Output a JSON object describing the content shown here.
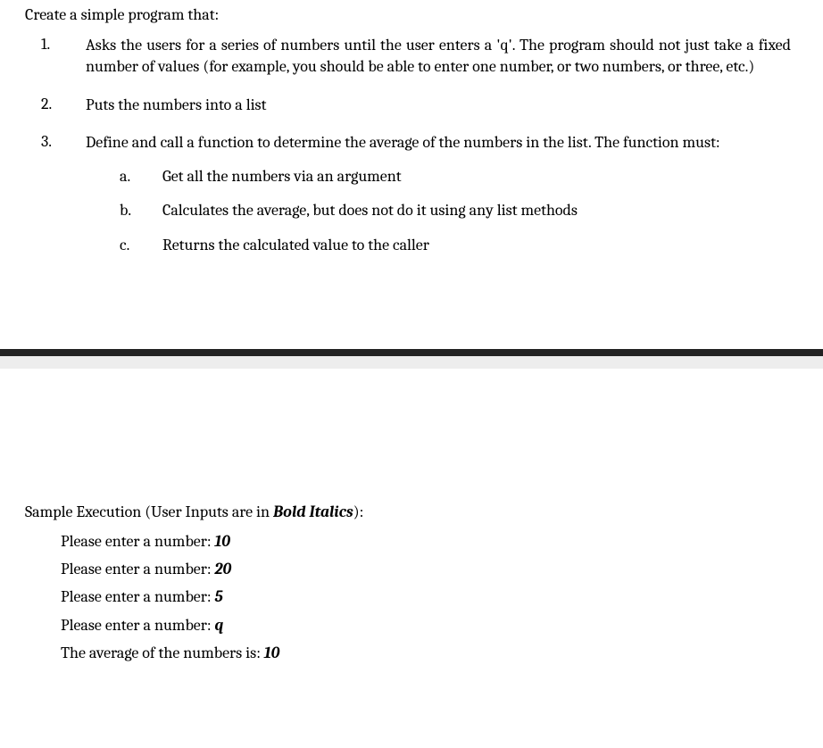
{
  "intro": "Create a simple program that:",
  "items": [
    {
      "num": "1.",
      "text": "Asks the users for a series of numbers until the user enters a 'q'.  The program should not just take a fixed number of values (for example, you should be able to enter one number, or two numbers, or three, etc.)"
    },
    {
      "num": "2.",
      "text": "Puts the numbers into a list"
    },
    {
      "num": "3.",
      "text": "Define and call a function to determine the average of the numbers in the list. The function must:"
    }
  ],
  "subitems": [
    {
      "num": "a.",
      "text": "Get all the numbers via an argument"
    },
    {
      "num": "b.",
      "text": "Calculates the average, but does not do it using any list methods"
    },
    {
      "num": "c.",
      "text": "Returns the calculated value to the caller"
    }
  ],
  "sample_title_prefix": "Sample Execution (User Inputs are in ",
  "sample_title_bold": "Bold Italics",
  "sample_title_suffix": "):",
  "exec": [
    {
      "prompt": "Please enter a number: ",
      "input": "10"
    },
    {
      "prompt": "Please enter a number: ",
      "input": "20"
    },
    {
      "prompt": "Please enter a number: ",
      "input": "5"
    },
    {
      "prompt": "Please enter a number: ",
      "input": "q"
    },
    {
      "prompt": "The average of the numbers is: ",
      "input": "10"
    }
  ]
}
